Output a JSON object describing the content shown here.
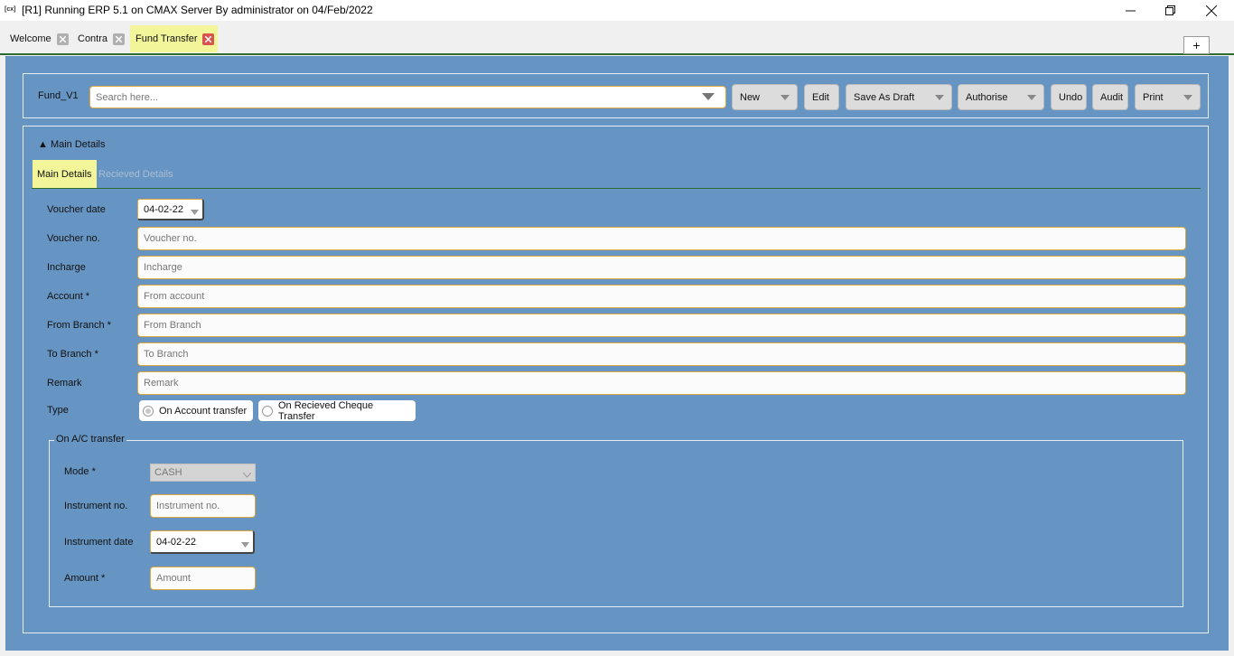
{
  "window": {
    "app_icon": "[cx]",
    "title": "[R1] Running ERP 5.1 on CMAX Server By administrator on 04/Feb/2022"
  },
  "tabs": [
    {
      "label": "Welcome",
      "active": false
    },
    {
      "label": "Contra",
      "active": false
    },
    {
      "label": "Fund Transfer",
      "active": true
    }
  ],
  "add_tab_label": "+",
  "toolbar": {
    "form_label": "Fund_V1",
    "search_placeholder": "Search here...",
    "buttons": {
      "new": "New",
      "edit": "Edit",
      "save_as_draft": "Save As Draft",
      "authorise": "Authorise",
      "undo": "Undo",
      "audit": "Audit",
      "print": "Print"
    }
  },
  "section": {
    "header": "▲ Main Details",
    "subtabs": [
      "Main Details",
      "Recieved Details"
    ]
  },
  "form": {
    "voucher_date": {
      "label": "Voucher date",
      "value": "04-02-22"
    },
    "voucher_no": {
      "label": "Voucher no.",
      "placeholder": "Voucher no."
    },
    "incharge": {
      "label": "Incharge",
      "placeholder": "Incharge"
    },
    "account": {
      "label": "Account *",
      "placeholder": "From account"
    },
    "from_branch": {
      "label": "From Branch *",
      "placeholder": "From Branch"
    },
    "to_branch": {
      "label": "To Branch *",
      "placeholder": "To Branch"
    },
    "remark": {
      "label": "Remark",
      "placeholder": "Remark"
    },
    "type": {
      "label": "Type",
      "options": [
        "On Account transfer",
        "On Recieved Cheque Transfer"
      ],
      "selected": "On Account transfer"
    }
  },
  "ac_transfer": {
    "legend": "On A/C transfer",
    "mode": {
      "label": "Mode *",
      "value": "CASH"
    },
    "instrument_no": {
      "label": "Instrument no.",
      "placeholder": "Instrument no."
    },
    "instrument_date": {
      "label": "Instrument date",
      "value": "04-02-22"
    },
    "amount": {
      "label": "Amount *",
      "placeholder": "Amount"
    }
  },
  "colors": {
    "main_background": "#6795c3",
    "active_tab": "#f2f59a",
    "input_border": "#e0a940",
    "accent_line": "#2e6b2e",
    "close_active": "#d9534f"
  }
}
